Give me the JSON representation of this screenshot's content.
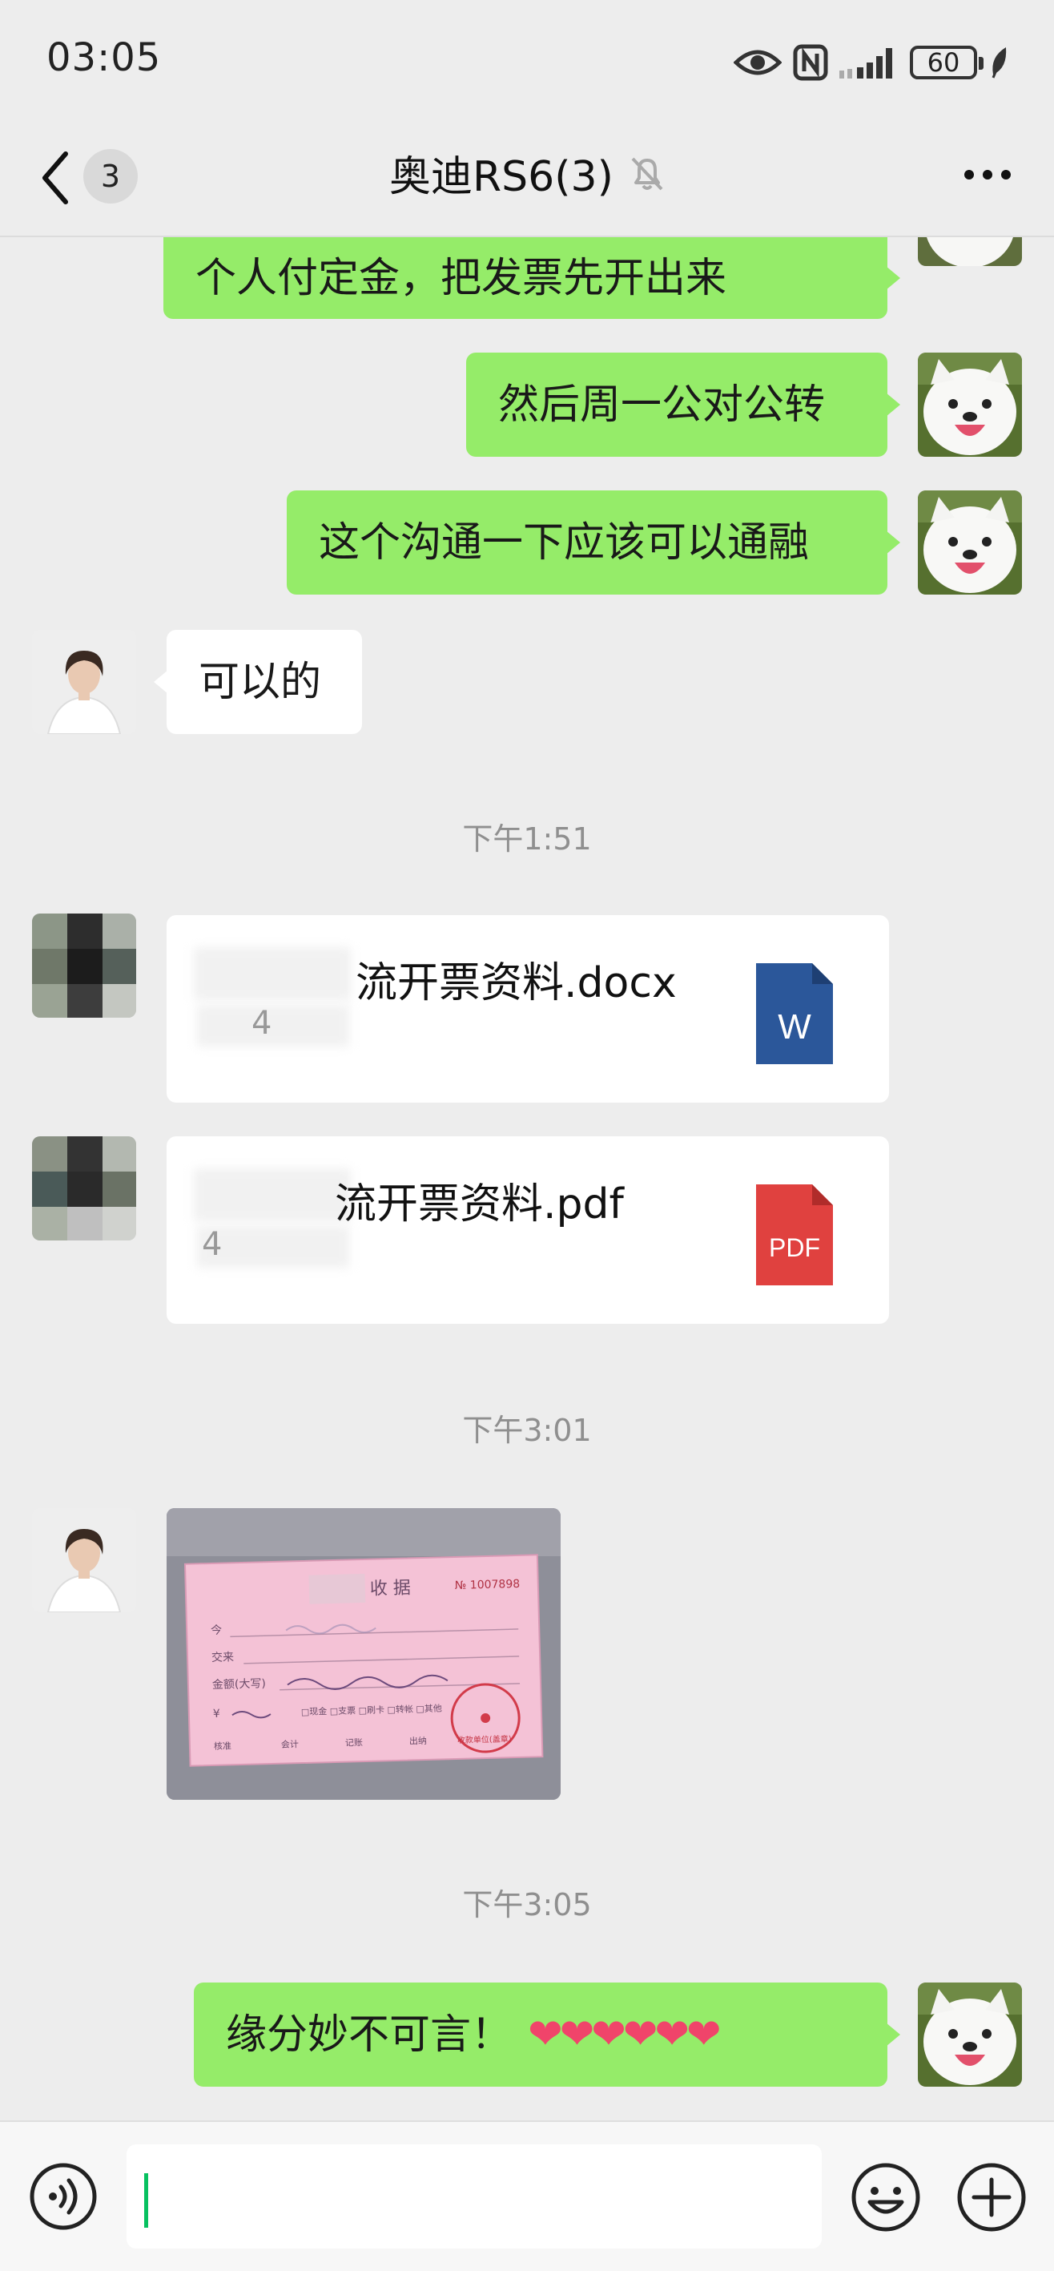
{
  "status_bar": {
    "time": "03:05",
    "battery": "60",
    "icons": [
      "eye-icon",
      "nfc-icon",
      "signal-icon",
      "battery-icon",
      "leaf-icon"
    ]
  },
  "header": {
    "back_icon": "chevron-left-icon",
    "unread_count": "3",
    "title": "奥迪RS6(3)",
    "mute_icon": "bell-off-icon",
    "more_icon": "more-dots-icon"
  },
  "messages": [
    {
      "side": "out",
      "text": "个人付定金，把发票先开出来"
    },
    {
      "side": "out",
      "text": "然后周一公对公转"
    },
    {
      "side": "out",
      "text": "这个沟通一下应该可以通融"
    },
    {
      "side": "in",
      "text": "可以的"
    },
    {
      "type": "time",
      "text": "下午1:51"
    },
    {
      "side": "in",
      "type": "file",
      "name": "流开票资料.docx",
      "size": "4",
      "icon": "word-file-icon",
      "icon_text": "W"
    },
    {
      "side": "in",
      "type": "file",
      "name": "流开票资料.pdf",
      "size": "4",
      "icon": "pdf-file-icon",
      "icon_text": "PDF"
    },
    {
      "type": "time",
      "text": "下午3:01"
    },
    {
      "side": "in",
      "type": "image",
      "photo_text": {
        "title": "收  据",
        "number": "№ 1007898",
        "row1": "今",
        "row2": "交来",
        "row3": "金额(大写)",
        "amount": "¥",
        "methods": "□现金 □支票 □刷卡 □转帐 □其他",
        "footer": [
          "核准",
          "会计",
          "记账",
          "出纳"
        ],
        "stamp": "收款单位(盖章)"
      }
    },
    {
      "type": "time",
      "text": "下午3:05"
    },
    {
      "side": "out",
      "text": "缘分妙不可言！",
      "emoji": "❤❤❤❤❤❤"
    }
  ],
  "input_bar": {
    "voice_icon": "voice-icon",
    "text_value": "",
    "emoji_icon": "emoji-icon",
    "plus_icon": "plus-icon"
  },
  "colors": {
    "background": "#ededed",
    "outgoing_bubble": "#95ec69",
    "incoming_bubble": "#ffffff",
    "word_icon": "#2b579a",
    "pdf_icon": "#e0413f",
    "caret": "#07c160"
  }
}
